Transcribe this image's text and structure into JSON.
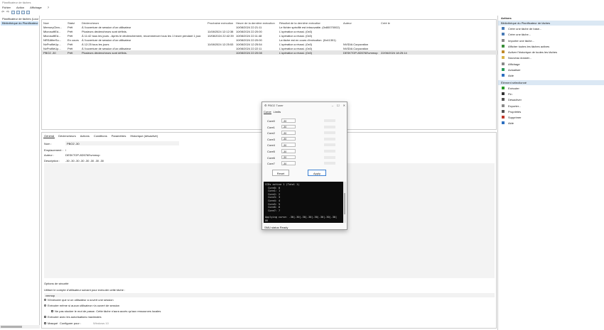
{
  "window": {
    "title": "Planificateur de tâches"
  },
  "menu": [
    "Fichier",
    "Action",
    "Affichage",
    "?"
  ],
  "tree": {
    "items": [
      "Planificateur de tâches (Local)",
      "Bibliothèque du Planificateur"
    ]
  },
  "tasklist": {
    "headers": [
      "Nom",
      "Statut",
      "Déclencheurs",
      "Prochaine exécution",
      "Heure de la dernière exécution",
      "Résultat de la dernière exécution",
      "Auteur",
      "Créé le"
    ],
    "rows": [
      [
        "MemoryClea...",
        "Prêt",
        "À l'ouverture de session d'un utilisateur",
        "",
        "10/08/2024 22:21:11",
        "Le fichier spécifié est introuvable. (0x80070002)",
        "",
        ""
      ],
      [
        "MicrosoftEd...",
        "Prêt",
        "Plusieurs déclencheurs sont définis.",
        "11/08/2024 12:12:38",
        "10/08/2024 22:20:00",
        "L'opération a réussi. (0x0)",
        "",
        ""
      ],
      [
        "MicrosoftEd...",
        "Prêt",
        "À 11:42 tous les jours - Après le déclenchement, recommencer tous les 1 heure pendant 1 jour.",
        "10/08/2024 22:42:39",
        "10/08/2024 22:11:48",
        "L'opération a réussi. (0x0)",
        "",
        ""
      ],
      [
        "NRSAfterSu...",
        "En cours",
        "À l'ouverture de session d'un utilisateur",
        "",
        "10/08/2024 22:20:00",
        "La tâche est en cours d'exécution. (0x41301)",
        "",
        ""
      ],
      [
        "NvProfileUp...",
        "Prêt",
        "À 12:25 tous les jours",
        "11/08/2024 12:25:53",
        "10/08/2024 12:25:54",
        "L'opération a réussi. (0x0)",
        "NVIDIA Corporation",
        ""
      ],
      [
        "NvProfileUp...",
        "Prêt",
        "À l'ouverture de session d'un utilisateur",
        "",
        "10/08/2024 22:22:11",
        "L'opération a réussi. (0x0)",
        "NVIDIA Corporation",
        ""
      ],
      [
        "PBO2 -30",
        "Prêt",
        "Plusieurs déclencheurs sont définis.",
        "",
        "10/08/2024 22:20:08",
        "L'opération a réussi. (0x0)",
        "DESKTOP-8D5760\\vmmop",
        "22/06/2024 18:25:14"
      ]
    ]
  },
  "detail": {
    "tabs": [
      "Général",
      "Déclencheurs",
      "Actions",
      "Conditions",
      "Paramètres",
      "Historique (désactivé)"
    ],
    "name_label": "Nom :",
    "name_value": "PBO2 -30",
    "location_label": "Emplacement :",
    "location_value": "\\",
    "author_label": "Auteur :",
    "author_value": "DESKTOP-8D5760\\vmmop",
    "desc_label": "Description :",
    "desc_value": "-30 -30 -30 -30 -30 -30 -30 -30",
    "security_title": "Options de sécurité",
    "security_account_label": "Utiliser le compte d'utilisateur suivant pour exécuter cette tâche :",
    "security_account": "vmmop",
    "opt_logged_on": "N'exécuter que si un utilisateur a ouvert une session",
    "opt_any": "Exécuter même si aucun utilisateur n'a ouvert de session",
    "opt_nopassword": "Ne pas stocker le mot de passe. Cette tâche n'aura accès qu'aux ressources locales",
    "opt_highest": "Exécuter avec les autorisations maximales",
    "hidden_label": "Masqué",
    "configure_label": "Configurer pour :",
    "configure_value": "Windows 10"
  },
  "actions": {
    "header": "Actions",
    "group1": "Bibliothèque du Planificateur de tâches",
    "group1_items": [
      "Créer une tâche de base...",
      "Créer une tâche...",
      "Importer une tâche...",
      "Afficher toutes les tâches actives",
      "Activer l'historique de toutes les tâches",
      "Nouveau dossier...",
      "Affichage",
      "Actualiser",
      "Aide"
    ],
    "group2": "Élément sélectionné",
    "group2_items": [
      "Exécuter",
      "Fin",
      "Désactiver",
      "Exporter...",
      "Propriétés",
      "Supprimer",
      "Aide"
    ]
  },
  "dialog": {
    "title": "PBO2 Tuner",
    "tabs": [
      "Curve",
      "Limits"
    ],
    "cores": [
      {
        "label": "Core0",
        "value": "-30"
      },
      {
        "label": "Core1",
        "value": "-30"
      },
      {
        "label": "Core2",
        "value": "-30"
      },
      {
        "label": "Core3",
        "value": "-30"
      },
      {
        "label": "Core4",
        "value": "-30"
      },
      {
        "label": "Core5",
        "value": "-30"
      },
      {
        "label": "Core6",
        "value": "-30"
      },
      {
        "label": "Core7",
        "value": "-30"
      }
    ],
    "reset_label": "Reset",
    "apply_label": "Apply",
    "console": "CCDs active 1 (Total 1)\n  Core0: 0\n  Core1: 1\n  Core2: 2\n  Core3: 3\n  Core4: 4\n  Core5: 5\n  Core6: 6\n  Core7: 7\n\nApplying curve: -30|-30|-30|-30|-30|-30|-30|-30|\nOK",
    "status": "SMU status Ready"
  }
}
